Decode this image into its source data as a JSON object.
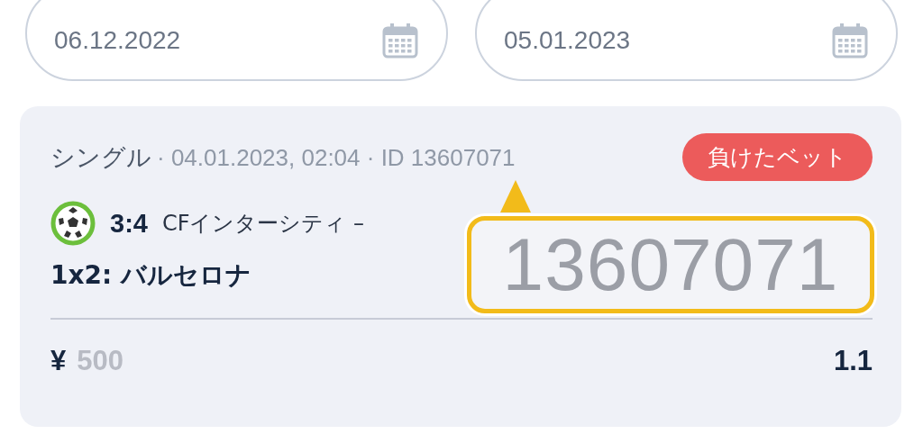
{
  "date_filter": {
    "from": "06.12.2022",
    "to": "05.01.2023"
  },
  "bet": {
    "type": "シングル",
    "meta": "· 04.01.2023, 02:04 · ID 13607071",
    "status": {
      "label": "負けたベット",
      "kind": "lost"
    },
    "score": "3:4",
    "match": "CFインターシティ –",
    "market": "1x2: バルセロナ",
    "currency": "¥",
    "stake": "500",
    "odds": "1.1"
  },
  "callout": {
    "text": "13607071"
  }
}
